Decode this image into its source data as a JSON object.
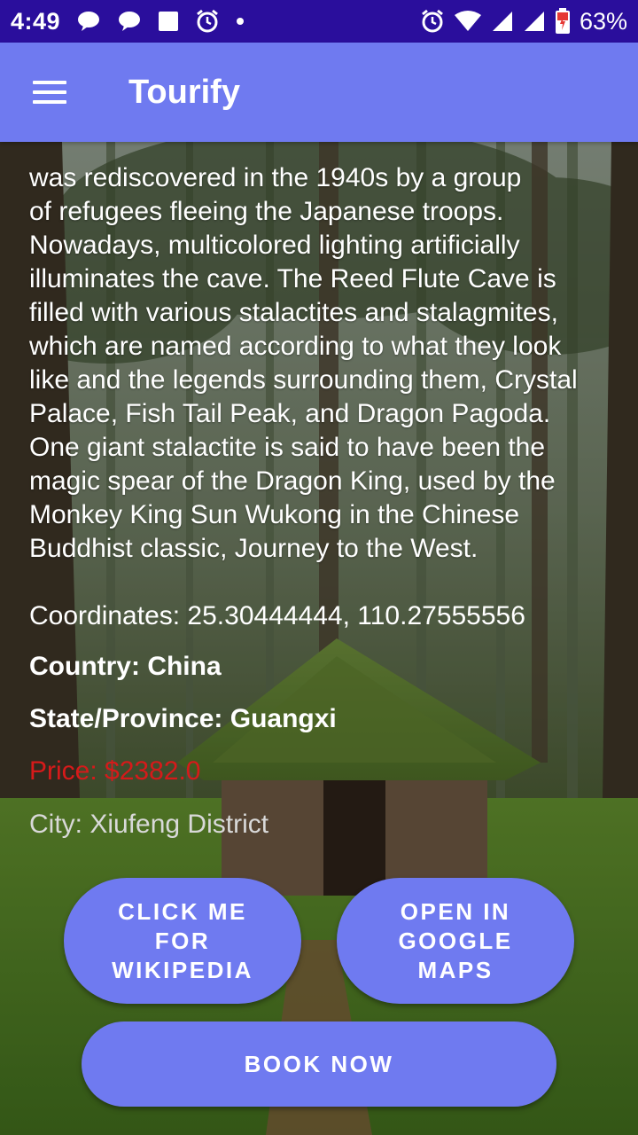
{
  "status_bar": {
    "time": "4:49",
    "battery": "63%",
    "left_icons": [
      "chat-bubble-icon",
      "chat-bubble-icon",
      "square-notification-icon",
      "alarm-icon",
      "dot-icon"
    ],
    "right_icons": [
      "alarm-icon",
      "wifi-icon",
      "signal-icon",
      "signal-icon",
      "battery-charging-icon"
    ]
  },
  "app_bar": {
    "title": "Tourify",
    "menu_icon": "hamburger-menu-icon",
    "color": "#6f7af0"
  },
  "details": {
    "description": "was rediscovered in the 1940s by a group\nof refugees fleeing the Japanese troops.\nNowadays, multicolored lighting artificially\nilluminates the cave. The Reed Flute Cave is\nfilled with various stalactites and stalagmites,\nwhich are named according to what they look\nlike and the legends surrounding them, Crystal\nPalace, Fish Tail Peak, and Dragon Pagoda.\nOne giant stalactite is said to have been the\nmagic spear of the Dragon King, used by the\nMonkey King Sun Wukong in the Chinese\nBuddhist classic, Journey to the West.",
    "coordinates": "Coordinates: 25.30444444, 110.27555556",
    "country": "Country: China",
    "state": "State/Province: Guangxi",
    "price": "Price: $2382.0",
    "city": "City: Xiufeng District"
  },
  "buttons": {
    "wikipedia": "CLICK ME\nFOR\nWIKIPEDIA",
    "maps": "OPEN IN\nGOOGLE\nMAPS",
    "book": "BOOK NOW"
  },
  "colors": {
    "status_bar": "#2a0e9c",
    "accent": "#6f7af0",
    "price": "#d61a1a"
  }
}
